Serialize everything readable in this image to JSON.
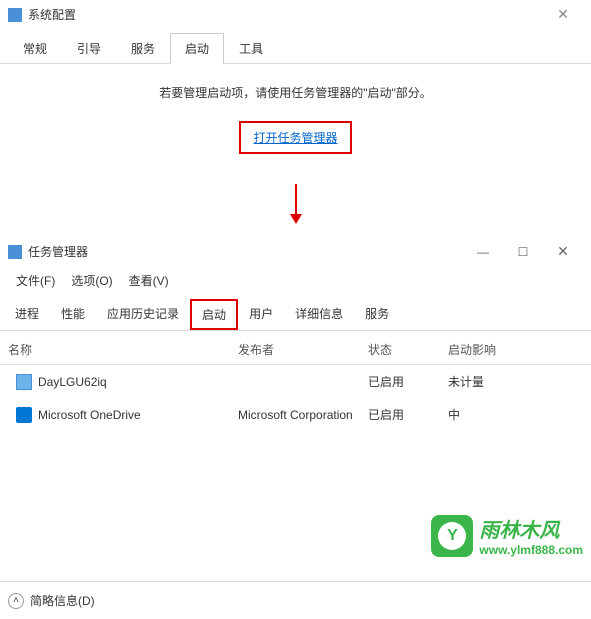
{
  "sysconfig": {
    "title": "系统配置",
    "tabs": [
      "常规",
      "引导",
      "服务",
      "启动",
      "工具"
    ],
    "active_tab": 3,
    "message": "若要管理启动项，请使用任务管理器的\"启动\"部分。",
    "link_text": "打开任务管理器"
  },
  "taskmgr": {
    "title": "任务管理器",
    "window_buttons": {
      "min": "—",
      "max": "☐",
      "close": "✕"
    },
    "menu": [
      "文件(F)",
      "选项(O)",
      "查看(V)"
    ],
    "tabs": [
      "进程",
      "性能",
      "应用历史记录",
      "启动",
      "用户",
      "详细信息",
      "服务"
    ],
    "active_tab": 3,
    "columns": {
      "name": "名称",
      "publisher": "发布者",
      "status": "状态",
      "impact": "启动影响"
    },
    "rows": [
      {
        "icon": "generic",
        "name": "DayLGU62iq",
        "publisher": "",
        "status": "已启用",
        "impact": "未计量"
      },
      {
        "icon": "onedrive",
        "name": "Microsoft OneDrive",
        "publisher": "Microsoft Corporation",
        "status": "已启用",
        "impact": "中"
      }
    ],
    "footer_text": "简略信息(D)"
  },
  "watermark": {
    "title": "雨林木风",
    "url": "www.ylmf888.com"
  }
}
